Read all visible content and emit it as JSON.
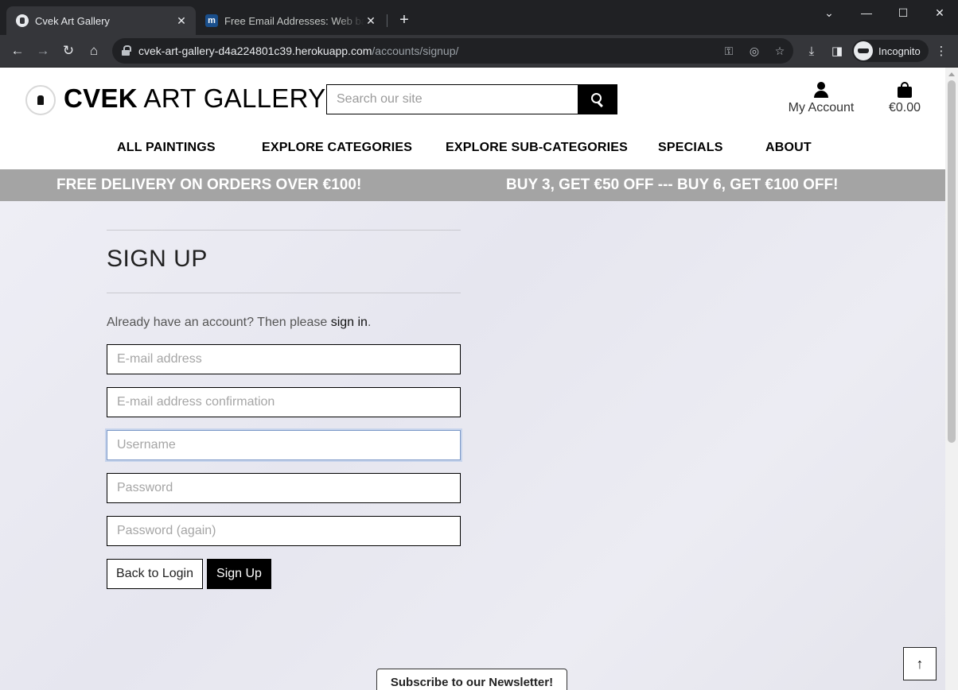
{
  "browser": {
    "tabs": [
      {
        "title": "Cvek Art Gallery",
        "active": true
      },
      {
        "title": "Free Email Addresses: Web based",
        "active": false
      }
    ],
    "new_tab_glyph": "+",
    "window_controls": {
      "minimize": "—",
      "maximize": "☐",
      "close": "✕",
      "tab_search": "⌄"
    },
    "url_host": "cvek-art-gallery-d4a224801c39.herokuapp.com",
    "url_path": "/accounts/signup/",
    "profile_label": "Incognito",
    "nav": {
      "back": "←",
      "forward": "→",
      "reload": "↻",
      "home": "⌂"
    },
    "icons": [
      "lock-icon",
      "key-icon",
      "eye-off-icon",
      "star-icon",
      "download-icon",
      "sidepanel-icon",
      "incognito-icon",
      "menu-icon"
    ]
  },
  "site": {
    "brand_bold": "CVEK",
    "brand_rest": " ART GALLERY",
    "search_placeholder": "Search our site",
    "account_label": "My Account",
    "bag_total": "€0.00",
    "nav": [
      "ALL PAINTINGS",
      "EXPLORE CATEGORIES",
      "EXPLORE SUB-CATEGORIES",
      "SPECIALS",
      "ABOUT"
    ],
    "banner_left": "FREE DELIVERY ON ORDERS OVER €100!",
    "banner_right": "BUY 3, GET €50 OFF --- BUY 6, GET €100 OFF!"
  },
  "signup": {
    "title": "SIGN UP",
    "intro_prefix": "Already have an account? Then please ",
    "intro_link": "sign in",
    "intro_suffix": ".",
    "fields": {
      "email": "E-mail address",
      "email_confirm": "E-mail address confirmation",
      "username": "Username",
      "password": "Password",
      "password_again": "Password (again)"
    },
    "back_button": "Back to Login",
    "submit_button": "Sign Up"
  },
  "footer": {
    "newsletter": "Subscribe to our Newsletter!",
    "back_to_top": "↑"
  }
}
